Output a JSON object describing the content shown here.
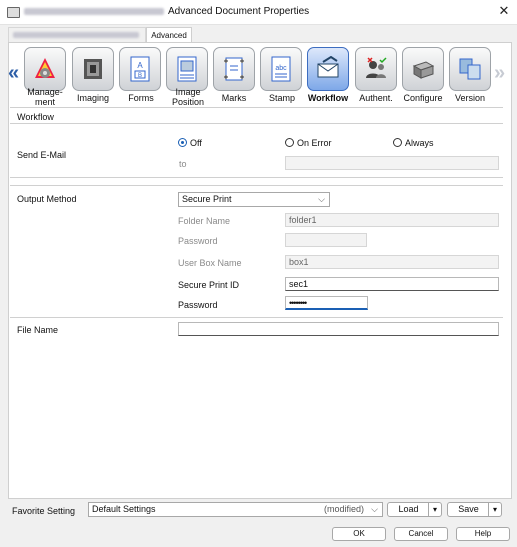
{
  "window": {
    "title": "Advanced Document Properties",
    "close_glyph": "✕"
  },
  "tabs": [
    {
      "label": ""
    },
    {
      "label": "Advanced"
    }
  ],
  "nav": {
    "left_arrow": "«",
    "right_arrow": "»"
  },
  "toolbar": [
    {
      "id": "management",
      "label1": "Manage-",
      "label2": "ment",
      "icon": "management-icon"
    },
    {
      "id": "imaging",
      "label1": "Imaging",
      "label2": "",
      "icon": "imaging-icon"
    },
    {
      "id": "forms",
      "label1": "Forms",
      "label2": "",
      "icon": "forms-icon"
    },
    {
      "id": "image-position",
      "label1": "Image",
      "label2": "Position",
      "icon": "image-position-icon"
    },
    {
      "id": "marks",
      "label1": "Marks",
      "label2": "",
      "icon": "marks-icon"
    },
    {
      "id": "stamp",
      "label1": "Stamp",
      "label2": "",
      "icon": "stamp-icon"
    },
    {
      "id": "workflow",
      "label1": "Workflow",
      "label2": "",
      "icon": "workflow-icon",
      "selected": true
    },
    {
      "id": "authent",
      "label1": "Authent.",
      "label2": "",
      "icon": "authentication-icon"
    },
    {
      "id": "configure",
      "label1": "Configure",
      "label2": "",
      "icon": "configure-icon"
    },
    {
      "id": "version",
      "label1": "Version",
      "label2": "",
      "icon": "version-icon"
    }
  ],
  "section_title": "Workflow",
  "send_email": {
    "label": "Send E-Mail",
    "options": [
      "Off",
      "On Error",
      "Always"
    ],
    "selected": "Off",
    "to_label": "to",
    "to_value": ""
  },
  "output": {
    "label": "Output Method",
    "method": "Secure Print",
    "folder_name_label": "Folder Name",
    "folder_name_value": "folder1",
    "password1_label": "Password",
    "password1_value": "",
    "user_box_label": "User Box Name",
    "user_box_value": "box1",
    "secure_id_label": "Secure Print ID",
    "secure_id_value": "sec1",
    "password2_label": "Password",
    "password2_value": "••••••••"
  },
  "file_name": {
    "label": "File Name",
    "value": ""
  },
  "favorite": {
    "label": "Favorite Setting",
    "value": "Default Settings",
    "modified": "(modified)",
    "load": "Load",
    "save": "Save"
  },
  "dialog_buttons": {
    "ok": "OK",
    "cancel": "Cancel",
    "help": "Help"
  },
  "colors": {
    "accent": "#1a5fb4",
    "selected_tab": "#7ea8e8"
  }
}
